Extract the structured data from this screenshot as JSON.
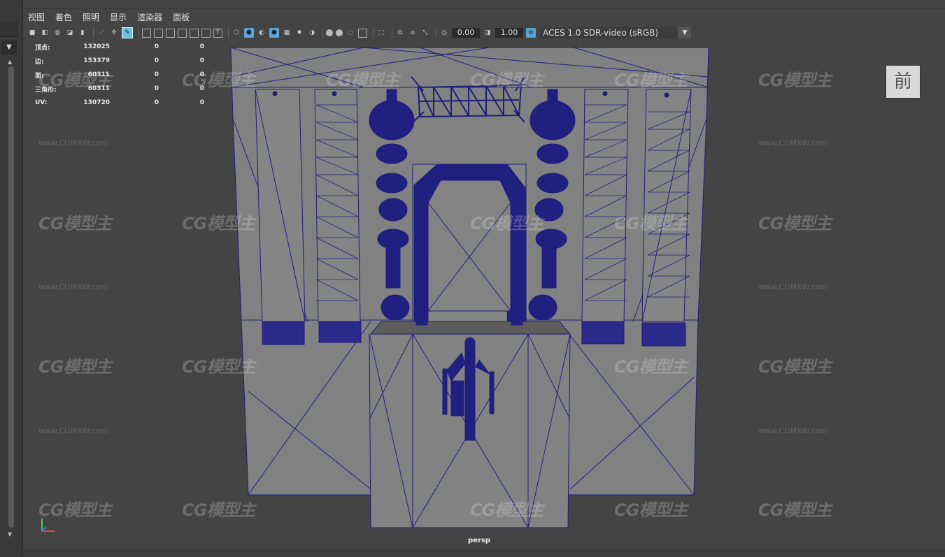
{
  "menu": {
    "items": [
      "视图",
      "着色",
      "照明",
      "显示",
      "渲染器",
      "面板"
    ]
  },
  "toolbar": {
    "exposure": "0.00",
    "gamma": "1.00",
    "color_space": "ACES 1.0 SDR-video (sRGB)"
  },
  "stats": {
    "rows": [
      {
        "label": "顶点:",
        "v1": "132025",
        "v2": "0",
        "v3": "0"
      },
      {
        "label": "边:",
        "v1": "153379",
        "v2": "0",
        "v3": "0"
      },
      {
        "label": "面:",
        "v1": "60311",
        "v2": "0",
        "v3": "0"
      },
      {
        "label": "三角形:",
        "v1": "60311",
        "v2": "0",
        "v3": "0"
      },
      {
        "label": "UV:",
        "v1": "130720",
        "v2": "0",
        "v3": "0"
      }
    ]
  },
  "viewcube_label": "前",
  "camera_label": "persp",
  "watermark": {
    "logo_text": "CG模型主",
    "url": "www.CGMXW.com"
  },
  "colors": {
    "wire": "#1e1e7a",
    "mesh_fill": "#818181",
    "viewport_bg": "#444444",
    "highlight_icon": "#5aa7d6"
  },
  "icons": [
    "camera-icon",
    "grid-icon",
    "wireframe-icon",
    "shaded-icon",
    "light-icon",
    "isolate-icon",
    "exposure-icon",
    "gamma-icon",
    "colormanage-icon"
  ]
}
